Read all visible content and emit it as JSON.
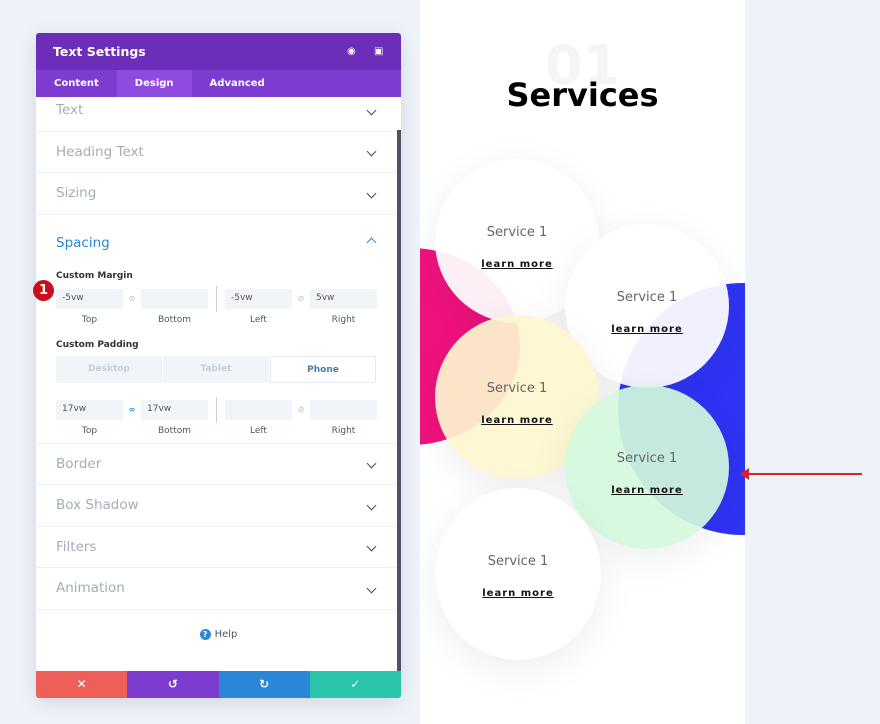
{
  "panel": {
    "title": "Text Settings",
    "icons": [
      "focus-icon",
      "sidebar-toggle-icon"
    ],
    "tabs": [
      "Content",
      "Design",
      "Advanced"
    ],
    "sections_top": [
      "Text",
      "Heading Text",
      "Sizing"
    ],
    "spacing": {
      "title": "Spacing",
      "margin_label": "Custom Margin",
      "margin": {
        "top": "-5vw",
        "bottom": "",
        "left": "-5vw",
        "right": "5vw"
      },
      "padding_label": "Custom Padding",
      "devices": [
        "Desktop",
        "Tablet",
        "Phone"
      ],
      "active_device": "Phone",
      "padding": {
        "top": "17vw",
        "bottom": "17vw",
        "left": "",
        "right": ""
      },
      "sides": [
        "Top",
        "Bottom",
        "Left",
        "Right"
      ]
    },
    "sections_bottom": [
      "Border",
      "Box Shadow",
      "Filters",
      "Animation"
    ],
    "help": "Help",
    "footer": {
      "colors": [
        "#ef5f5a",
        "#7e3bd0",
        "#2b87da",
        "#29c4a9"
      ],
      "icons": [
        "close-icon",
        "undo-icon",
        "redo-icon",
        "check-icon"
      ]
    }
  },
  "badge": "1",
  "preview": {
    "number": "01",
    "title": "Services",
    "circles": [
      {
        "label": "Service 1",
        "link": "learn more"
      },
      {
        "label": "Service 1",
        "link": "learn more"
      },
      {
        "label": "Service 1",
        "link": "learn more"
      },
      {
        "label": "Service 1",
        "link": "learn more"
      },
      {
        "label": "Service 1",
        "link": "learn more"
      }
    ],
    "colors": {
      "pink": "#f0127e",
      "blue": "#2f34f5",
      "yellow": "#fdf6cf",
      "green": "#d4f9dc"
    }
  }
}
